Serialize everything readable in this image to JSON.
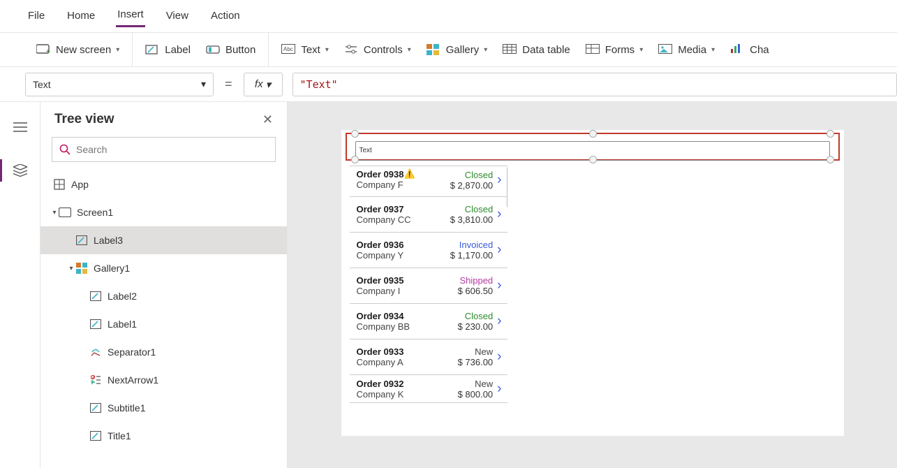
{
  "menu": {
    "items": [
      "File",
      "Home",
      "Insert",
      "View",
      "Action"
    ],
    "active_index": 2
  },
  "toolbar": {
    "new_screen": "New screen",
    "label": "Label",
    "button": "Button",
    "text": "Text",
    "controls": "Controls",
    "gallery": "Gallery",
    "data_table": "Data table",
    "forms": "Forms",
    "media": "Media",
    "charts": "Cha"
  },
  "formula": {
    "property": "Text",
    "fx": "fx",
    "value": "\"Text\""
  },
  "tree": {
    "title": "Tree view",
    "search_placeholder": "Search",
    "items": [
      {
        "label": "App",
        "icon": "app",
        "indent": 0,
        "caret": ""
      },
      {
        "label": "Screen1",
        "icon": "screen",
        "indent": 1,
        "caret": "▾"
      },
      {
        "label": "Label3",
        "icon": "label",
        "indent": 2,
        "caret": "",
        "selected": true
      },
      {
        "label": "Gallery1",
        "icon": "gallery",
        "indent": 2,
        "caret": "▾"
      },
      {
        "label": "Label2",
        "icon": "label",
        "indent": 3,
        "caret": ""
      },
      {
        "label": "Label1",
        "icon": "label",
        "indent": 3,
        "caret": ""
      },
      {
        "label": "Separator1",
        "icon": "separator",
        "indent": 3,
        "caret": ""
      },
      {
        "label": "NextArrow1",
        "icon": "nextarrow",
        "indent": 3,
        "caret": ""
      },
      {
        "label": "Subtitle1",
        "icon": "label",
        "indent": 3,
        "caret": ""
      },
      {
        "label": "Title1",
        "icon": "label",
        "indent": 3,
        "caret": ""
      }
    ]
  },
  "canvas": {
    "label_text": "Text",
    "gallery_rows": [
      {
        "order": "Order 0938",
        "company": "Company F",
        "status": "Closed",
        "status_class": "st-closed",
        "amount": "$ 2,870.00",
        "warn": true
      },
      {
        "order": "Order 0937",
        "company": "Company CC",
        "status": "Closed",
        "status_class": "st-closed",
        "amount": "$ 3,810.00"
      },
      {
        "order": "Order 0936",
        "company": "Company Y",
        "status": "Invoiced",
        "status_class": "st-invoiced",
        "amount": "$ 1,170.00"
      },
      {
        "order": "Order 0935",
        "company": "Company I",
        "status": "Shipped",
        "status_class": "st-shipped",
        "amount": "$ 606.50"
      },
      {
        "order": "Order 0934",
        "company": "Company BB",
        "status": "Closed",
        "status_class": "st-closed",
        "amount": "$ 230.00"
      },
      {
        "order": "Order 0933",
        "company": "Company A",
        "status": "New",
        "status_class": "st-new",
        "amount": "$ 736.00"
      },
      {
        "order": "Order 0932",
        "company": "Company K",
        "status": "New",
        "status_class": "st-new",
        "amount": "$ 800.00"
      }
    ]
  }
}
